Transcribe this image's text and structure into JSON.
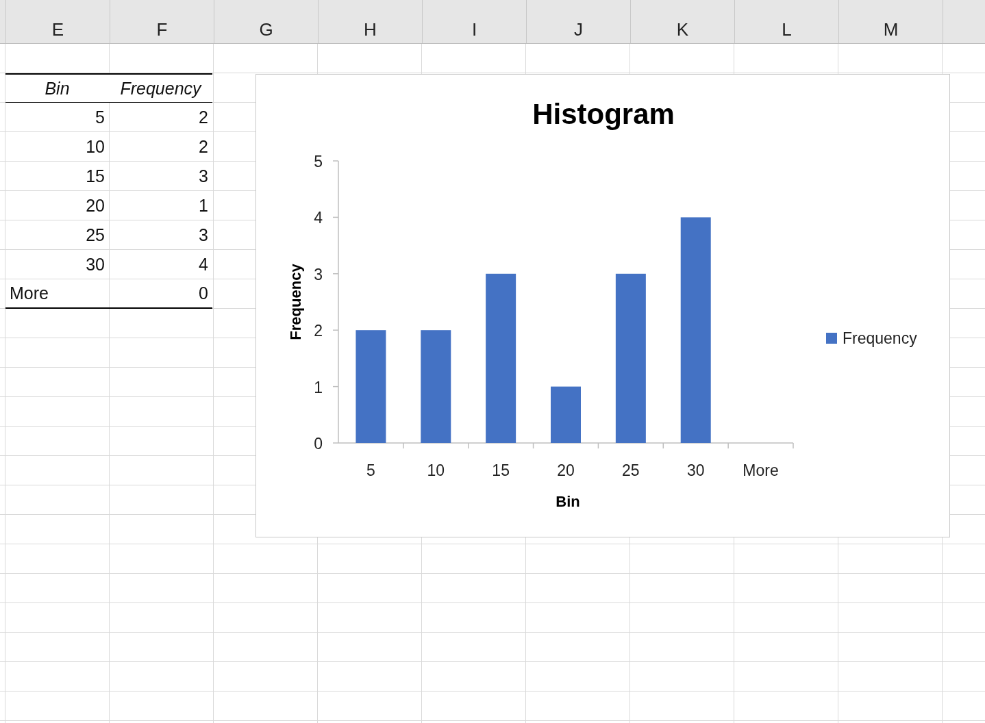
{
  "column_headers": [
    "E",
    "F",
    "G",
    "H",
    "I",
    "J",
    "K",
    "L",
    "M"
  ],
  "table": {
    "columns": [
      "Bin",
      "Frequency"
    ],
    "rows": [
      [
        "5",
        "2"
      ],
      [
        "10",
        "2"
      ],
      [
        "15",
        "3"
      ],
      [
        "20",
        "1"
      ],
      [
        "25",
        "3"
      ],
      [
        "30",
        "4"
      ],
      [
        "More",
        "0"
      ]
    ]
  },
  "chart": {
    "chart_data": {
      "type": "bar",
      "title": "Histogram",
      "xlabel": "Bin",
      "ylabel": "Frequency",
      "categories": [
        "5",
        "10",
        "15",
        "20",
        "25",
        "30",
        "More"
      ],
      "series": [
        {
          "name": "Frequency",
          "color": "#4472c4",
          "values": [
            2,
            2,
            3,
            1,
            3,
            4,
            0
          ]
        }
      ],
      "ylim": [
        0,
        5
      ],
      "yticks": [
        0,
        1,
        2,
        3,
        4,
        5
      ]
    }
  }
}
